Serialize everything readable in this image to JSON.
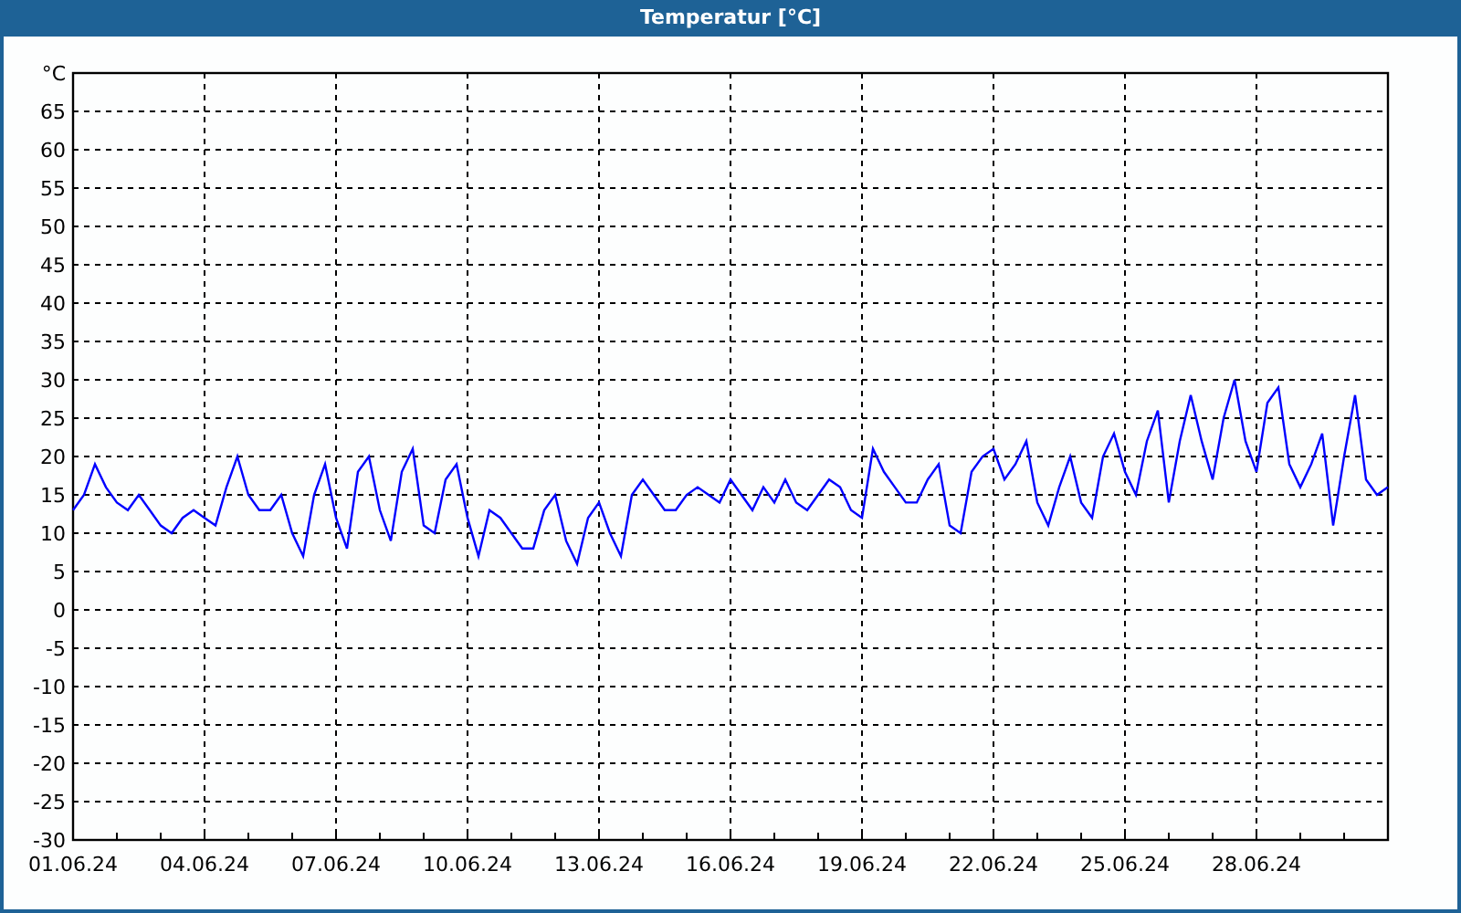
{
  "window": {
    "title": "Temperatur [°C]"
  },
  "chart": {
    "chart_data": {
      "type": "line",
      "grid": true,
      "ylim": [
        -30,
        70
      ],
      "yticks": [
        -30,
        -25,
        -20,
        -15,
        -10,
        -5,
        0,
        5,
        10,
        15,
        20,
        25,
        30,
        35,
        40,
        45,
        50,
        55,
        60,
        65,
        {
          "value": 70,
          "label": "°C"
        }
      ],
      "categories": [
        "01.06.24",
        null,
        null,
        null,
        null,
        null,
        null,
        null,
        null,
        null,
        null,
        null,
        "04.06.24",
        null,
        null,
        null,
        null,
        null,
        null,
        null,
        null,
        null,
        null,
        null,
        "07.06.24",
        null,
        null,
        null,
        null,
        null,
        null,
        null,
        null,
        null,
        null,
        null,
        "10.06.24",
        null,
        null,
        null,
        null,
        null,
        null,
        null,
        null,
        null,
        null,
        null,
        "13.06.24",
        null,
        null,
        null,
        null,
        null,
        null,
        null,
        null,
        null,
        null,
        null,
        "16.06.24",
        null,
        null,
        null,
        null,
        null,
        null,
        null,
        null,
        null,
        null,
        null,
        "19.06.24",
        null,
        null,
        null,
        null,
        null,
        null,
        null,
        null,
        null,
        null,
        null,
        "22.06.24",
        null,
        null,
        null,
        null,
        null,
        null,
        null,
        null,
        null,
        null,
        null,
        "25.06.24",
        null,
        null,
        null,
        null,
        null,
        null,
        null,
        null,
        null,
        null,
        null,
        "28.06.24",
        null,
        null,
        null,
        null,
        null,
        null,
        null,
        null,
        null,
        null,
        null,
        null
      ],
      "series": [
        {
          "color": "#0000ff",
          "values": [
            13,
            15,
            19,
            16,
            14,
            13,
            15,
            13,
            11,
            10,
            12,
            13,
            12,
            11,
            16,
            20,
            15,
            13,
            13,
            15,
            10,
            7,
            15,
            19,
            12,
            8,
            18,
            20,
            13,
            9,
            18,
            21,
            11,
            10,
            17,
            19,
            12,
            7,
            13,
            12,
            10,
            8,
            8,
            13,
            15,
            9,
            6,
            12,
            14,
            10,
            7,
            15,
            17,
            15,
            13,
            13,
            15,
            16,
            15,
            14,
            17,
            15,
            13,
            16,
            14,
            17,
            14,
            13,
            15,
            17,
            16,
            13,
            12,
            21,
            18,
            16,
            14,
            14,
            17,
            19,
            11,
            10,
            18,
            20,
            21,
            17,
            19,
            22,
            14,
            11,
            16,
            20,
            14,
            12,
            20,
            23,
            18,
            15,
            22,
            26,
            14,
            22,
            28,
            22,
            17,
            25,
            30,
            22,
            18,
            27,
            29,
            19,
            16,
            19,
            23,
            11,
            20,
            28,
            17,
            15,
            16
          ]
        }
      ]
    }
  }
}
